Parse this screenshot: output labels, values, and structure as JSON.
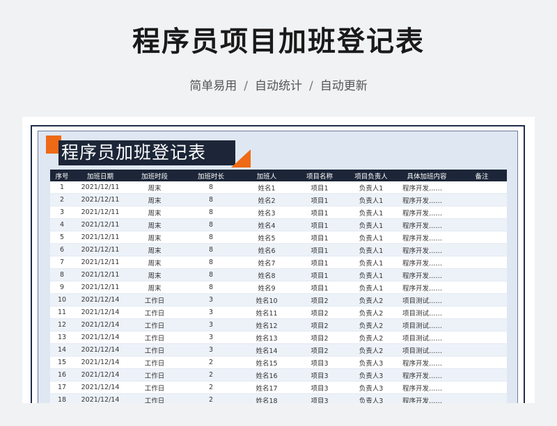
{
  "header": {
    "title": "程序员项目加班登记表",
    "subtitle_items": [
      "简单易用",
      "自动统计",
      "自动更新"
    ],
    "separator": "/"
  },
  "sheet": {
    "banner_title": "程序员加班登记表",
    "columns": [
      "序号",
      "加班日期",
      "加班时段",
      "加班时长",
      "加班人",
      "项目名称",
      "项目负责人",
      "具体加班内容",
      "备注"
    ],
    "rows": [
      [
        "1",
        "2021/12/11",
        "周末",
        "8",
        "姓名1",
        "项目1",
        "负责人1",
        "程序开发……",
        ""
      ],
      [
        "2",
        "2021/12/11",
        "周末",
        "8",
        "姓名2",
        "项目1",
        "负责人1",
        "程序开发……",
        ""
      ],
      [
        "3",
        "2021/12/11",
        "周末",
        "8",
        "姓名3",
        "项目1",
        "负责人1",
        "程序开发……",
        ""
      ],
      [
        "4",
        "2021/12/11",
        "周末",
        "8",
        "姓名4",
        "项目1",
        "负责人1",
        "程序开发……",
        ""
      ],
      [
        "5",
        "2021/12/11",
        "周末",
        "8",
        "姓名5",
        "项目1",
        "负责人1",
        "程序开发……",
        ""
      ],
      [
        "6",
        "2021/12/11",
        "周末",
        "8",
        "姓名6",
        "项目1",
        "负责人1",
        "程序开发……",
        ""
      ],
      [
        "7",
        "2021/12/11",
        "周末",
        "8",
        "姓名7",
        "项目1",
        "负责人1",
        "程序开发……",
        ""
      ],
      [
        "8",
        "2021/12/11",
        "周末",
        "8",
        "姓名8",
        "项目1",
        "负责人1",
        "程序开发……",
        ""
      ],
      [
        "9",
        "2021/12/11",
        "周末",
        "8",
        "姓名9",
        "项目1",
        "负责人1",
        "程序开发……",
        ""
      ],
      [
        "10",
        "2021/12/14",
        "工作日",
        "3",
        "姓名10",
        "项目2",
        "负责人2",
        "项目测试……",
        ""
      ],
      [
        "11",
        "2021/12/14",
        "工作日",
        "3",
        "姓名11",
        "项目2",
        "负责人2",
        "项目测试……",
        ""
      ],
      [
        "12",
        "2021/12/14",
        "工作日",
        "3",
        "姓名12",
        "项目2",
        "负责人2",
        "项目测试……",
        ""
      ],
      [
        "13",
        "2021/12/14",
        "工作日",
        "3",
        "姓名13",
        "项目2",
        "负责人2",
        "项目测试……",
        ""
      ],
      [
        "14",
        "2021/12/14",
        "工作日",
        "3",
        "姓名14",
        "项目2",
        "负责人2",
        "项目测试……",
        ""
      ],
      [
        "15",
        "2021/12/14",
        "工作日",
        "2",
        "姓名15",
        "项目3",
        "负责人3",
        "程序开发……",
        ""
      ],
      [
        "16",
        "2021/12/14",
        "工作日",
        "2",
        "姓名16",
        "项目3",
        "负责人3",
        "程序开发……",
        ""
      ],
      [
        "17",
        "2021/12/14",
        "工作日",
        "2",
        "姓名17",
        "项目3",
        "负责人3",
        "程序开发……",
        ""
      ],
      [
        "18",
        "2021/12/14",
        "工作日",
        "2",
        "姓名18",
        "项目3",
        "负责人3",
        "程序开发……",
        ""
      ]
    ]
  },
  "colors": {
    "header_bg": "#1c2638",
    "accent_orange": "#ee6a16",
    "sheet_bg": "#dfe7f3",
    "row_alt": "#edf2f9"
  }
}
